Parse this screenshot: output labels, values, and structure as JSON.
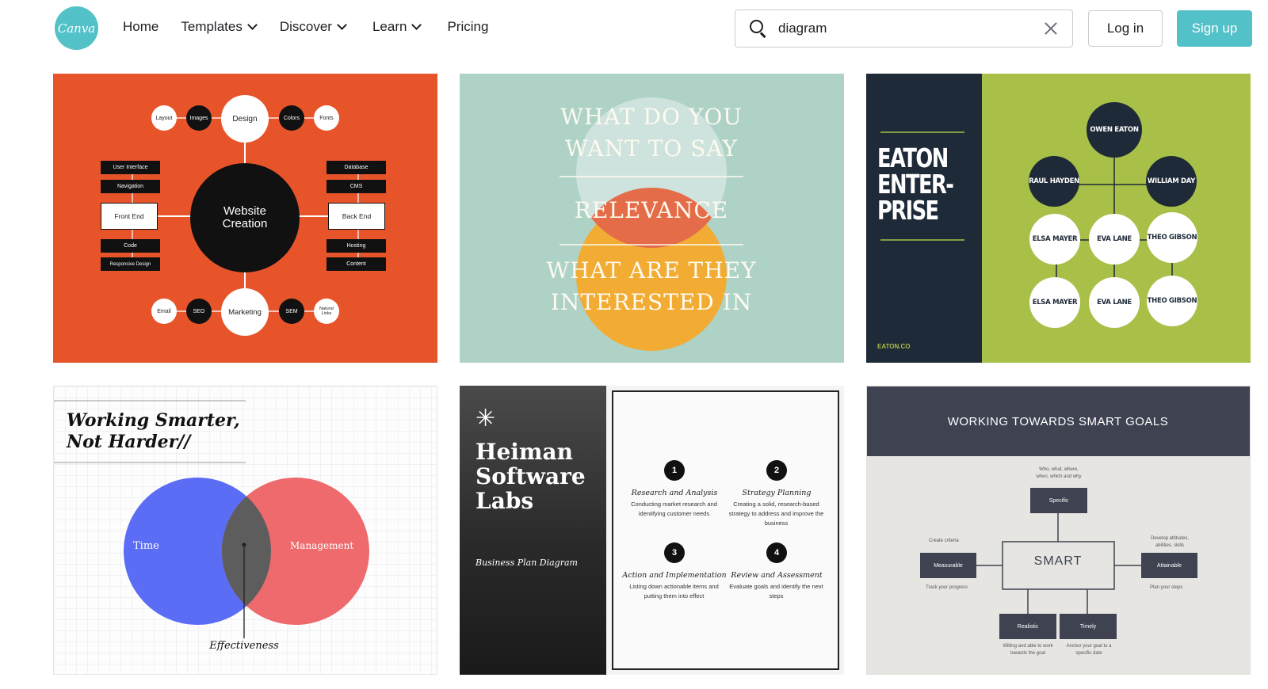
{
  "header": {
    "logo_text": "Canva",
    "nav": [
      {
        "label": "Home"
      },
      {
        "label": "Templates"
      },
      {
        "label": "Discover"
      },
      {
        "label": "Learn"
      },
      {
        "label": "Pricing"
      }
    ],
    "search": {
      "value": "diagram"
    },
    "login_label": "Log in",
    "signup_label": "Sign up"
  },
  "colors": {
    "brand": "#52c1c8",
    "card1_bg": "#e8542a",
    "card2_bg": "#aed2c6",
    "card3_bg": "#a8bf48",
    "card3_navy": "#1e2a38",
    "card6_header": "#3e4251",
    "venn_blue": "#5b6cf5",
    "venn_red": "#ee6a6c"
  },
  "templates": [
    {
      "id": "website-creation",
      "center_title": "Website Creation",
      "top_node": "Design",
      "bottom_node": "Marketing",
      "top_small": [
        "Layout",
        "Images",
        "Colors",
        "Fonts"
      ],
      "bottom_small": [
        "Email",
        "SEO",
        "SEM",
        "Natural Links"
      ],
      "left_main": "Front End",
      "right_main": "Back End",
      "left_items": [
        "User Interface",
        "Navigation",
        "Code",
        "Responsive Design"
      ],
      "right_items": [
        "Database",
        "CMS",
        "Hosting",
        "Content"
      ]
    },
    {
      "id": "relevance",
      "line1": "WHAT DO YOU",
      "line2": "WANT TO SAY",
      "middle": "RELEVANCE",
      "line3": "WHAT ARE THEY",
      "line4": "INTERESTED IN"
    },
    {
      "id": "eaton",
      "title_lines": [
        "EATON",
        "ENTER-",
        "PRISE"
      ],
      "footer": "EATON.CO",
      "people": {
        "top": "OWEN EATON",
        "left": "RAUL HAYDEN",
        "right": "WILLIAM DAY",
        "row2": [
          "ELSA MAYER",
          "EVA LANE",
          "THEO GIBSON"
        ],
        "row3": [
          "ELSA MAYER",
          "EVA LANE",
          "THEO GIBSON"
        ]
      }
    },
    {
      "id": "venn",
      "title_line1": "Working Smarter,",
      "title_line2": "Not Harder//",
      "left_label": "Time",
      "right_label": "Management",
      "bottom_label": "Effectiveness"
    },
    {
      "id": "heiman",
      "title_lines": [
        "Heiman",
        "Software",
        "Labs"
      ],
      "subtitle": "Business Plan Diagram",
      "steps": [
        {
          "num": "1",
          "title": "Research and Analysis",
          "desc": "Conducting market research and identifying customer needs"
        },
        {
          "num": "2",
          "title": "Strategy Planning",
          "desc": "Creating a solid, research-based strategy to address and improve the business"
        },
        {
          "num": "3",
          "title": "Action and Implementation",
          "desc": "Listing down actionable items and putting them into effect"
        },
        {
          "num": "4",
          "title": "Review and Assessment",
          "desc": "Evaluate goals and identify the next steps"
        }
      ]
    },
    {
      "id": "smart-goals",
      "title": "WORKING TOWARDS SMART GOALS",
      "center": "SMART",
      "boxes": {
        "top": "Specific",
        "left": "Measurable",
        "right": "Attainable",
        "bottom_left": "Realistic",
        "bottom_right": "Timely"
      },
      "notes": {
        "top": "Who, what, where, when, which and why",
        "left_top": "Create criteria",
        "left_bottom": "Track your progress",
        "right_top": "Develop attitudes, abilities, skills",
        "right_bottom": "Plan your steps",
        "bottom_left": "Willing and able to work towards the goal",
        "bottom_right": "Anchor your goal to a specific date"
      }
    }
  ]
}
